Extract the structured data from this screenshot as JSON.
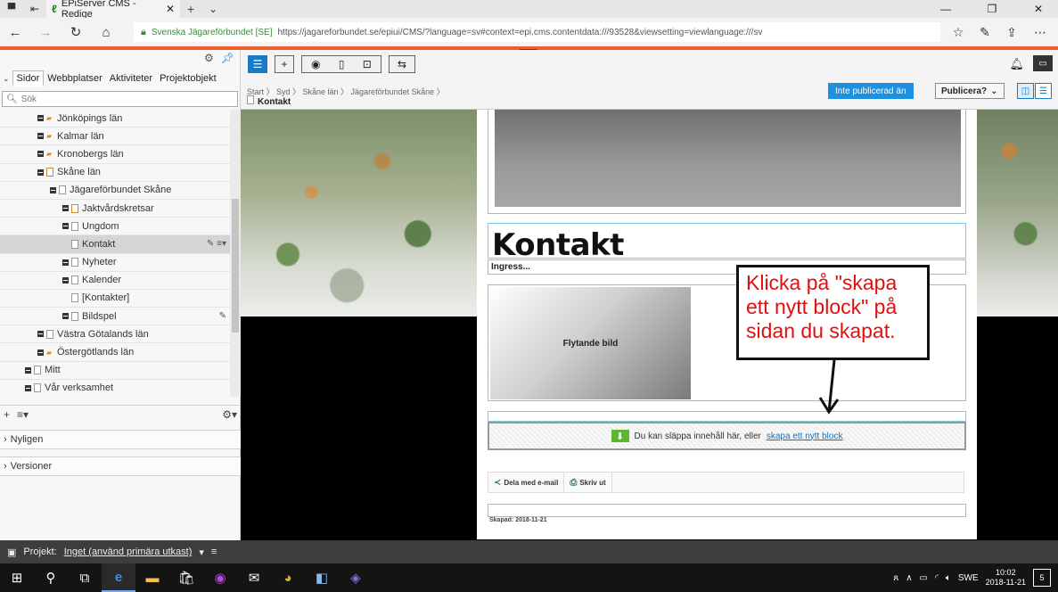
{
  "browser": {
    "tab_title": "EPiServer CMS - Redige",
    "site_identity": "Svenska Jägareförbundet [SE]",
    "url": "https://jagareforbundet.se/epiui/CMS/?language=sv#context=epi.cms.contentdata:///93528&viewsetting=viewlanguage:///sv"
  },
  "left_pane": {
    "tabs": [
      "Sidor",
      "Webbplatser",
      "Aktiviteter",
      "Projektobjekt"
    ],
    "search_placeholder": "Sök",
    "tree": [
      {
        "label": "Jönköpings län",
        "depth": 1,
        "icon": "pin"
      },
      {
        "label": "Kalmar län",
        "depth": 1,
        "icon": "pin"
      },
      {
        "label": "Kronobergs län",
        "depth": 1,
        "icon": "pin"
      },
      {
        "label": "Skåne län",
        "depth": 1,
        "icon": "page-lock"
      },
      {
        "label": "Jägareförbundet Skåne",
        "depth": 2,
        "icon": "page"
      },
      {
        "label": "Jaktvårdskretsar",
        "depth": 3,
        "icon": "page-lock"
      },
      {
        "label": "Ungdom",
        "depth": 3,
        "icon": "page"
      },
      {
        "label": "Kontakt",
        "depth": 3,
        "icon": "page",
        "selected": true
      },
      {
        "label": "Nyheter",
        "depth": 3,
        "icon": "page"
      },
      {
        "label": "Kalender",
        "depth": 3,
        "icon": "page"
      },
      {
        "label": "[Kontakter]",
        "depth": 3,
        "icon": "page"
      },
      {
        "label": "Bildspel",
        "depth": 3,
        "icon": "page"
      },
      {
        "label": "Västra Götalands län",
        "depth": 1,
        "icon": "page"
      },
      {
        "label": "Östergötlands län",
        "depth": 1,
        "icon": "pin"
      },
      {
        "label": "Mitt",
        "depth": 0,
        "icon": "page"
      },
      {
        "label": "Vår verksamhet",
        "depth": 0,
        "icon": "page"
      }
    ],
    "gadgets": [
      "Nyligen",
      "Versioner"
    ]
  },
  "editor": {
    "breadcrumb": "Start 〉 Syd 〉 Skåne län 〉 Jägareförbundet Skåne 〉",
    "page_name": "Kontakt",
    "status": "Inte publicerad än",
    "publish_label": "Publicera?"
  },
  "preview": {
    "title": "Kontakt",
    "ingress": "Ingress...",
    "floating_image": "Flytande bild",
    "drop_text": "Du kan släppa innehåll här, eller",
    "drop_link": "skapa ett nytt block",
    "share_email": "Dela med e-mail",
    "share_print": "Skriv ut",
    "created": "Skapad: 2018-11-21"
  },
  "callout": {
    "text": "Klicka på \"skapa ett nytt block\" på sidan du skapat."
  },
  "project_bar": {
    "label": "Projekt:",
    "value": "Inget (använd primära utkast)"
  },
  "taskbar": {
    "language": "SWE",
    "time": "10:02",
    "date": "2018-11-21",
    "notifications": "5"
  },
  "colors": {
    "accent_orange": "#ec5d2e",
    "status_blue": "#1e90e0",
    "callout_red": "#e01010"
  }
}
